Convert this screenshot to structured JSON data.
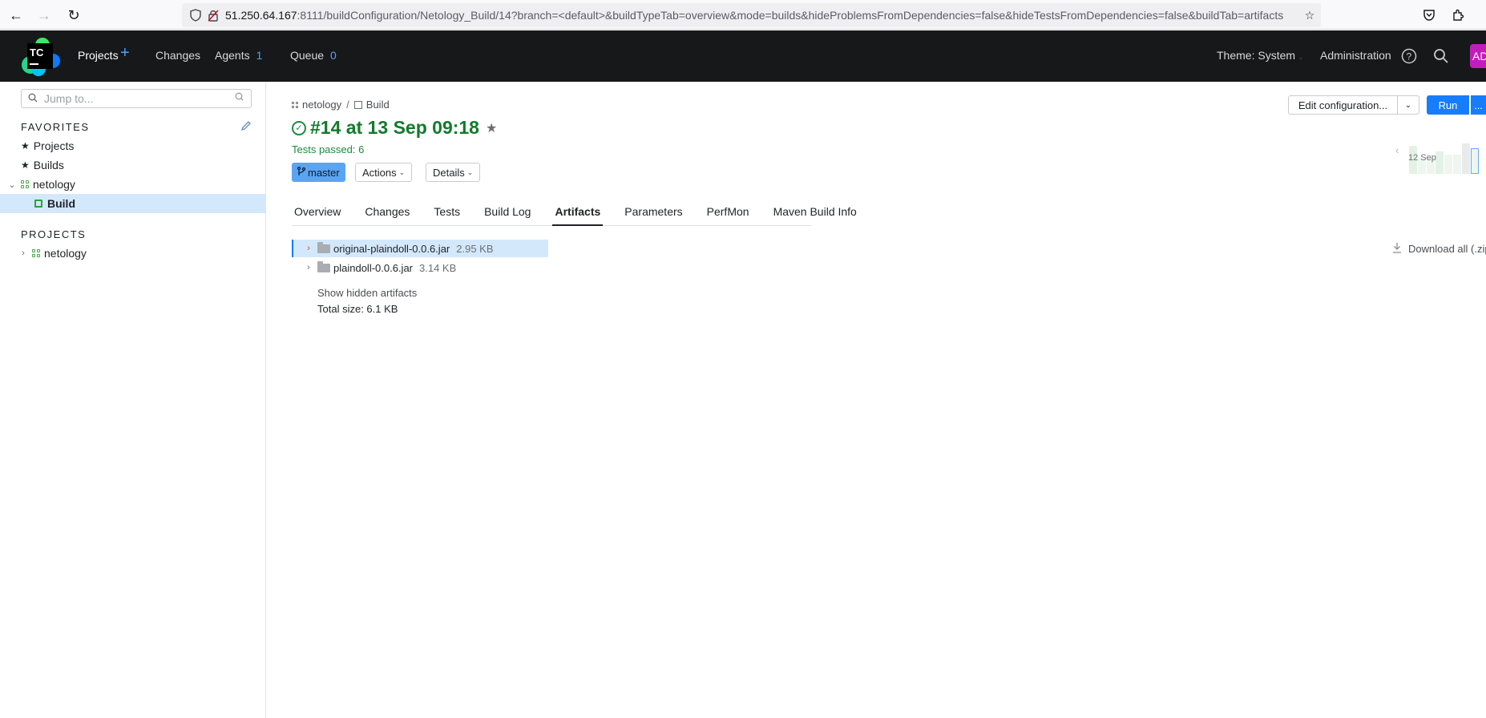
{
  "browser": {
    "url_host": "51.250.64.167",
    "url_rest": ":8111/buildConfiguration/Netology_Build/14?branch=<default>&buildTypeTab=overview&mode=builds&hideProblemsFromDependencies=false&hideTestsFromDependencies=false&buildTab=artifacts"
  },
  "header": {
    "logo_text": "TC",
    "projects": "Projects",
    "changes": "Changes",
    "agents": "Agents",
    "agents_count": "1",
    "queue": "Queue",
    "queue_count": "0",
    "theme": "Theme: System",
    "administration": "Administration",
    "avatar": "AD"
  },
  "sidebar": {
    "search_placeholder": "Jump to...",
    "favorites_title": "FAVORITES",
    "favorites": [
      {
        "label": "Projects"
      },
      {
        "label": "Builds"
      },
      {
        "label": "netology"
      },
      {
        "label": "Build"
      }
    ],
    "projects_title": "PROJECTS",
    "projects": [
      {
        "label": "netology"
      }
    ]
  },
  "breadcrumb": {
    "project": "netology",
    "separator": "/",
    "build": "Build"
  },
  "build": {
    "title": "#14 at 13 Sep 09:18",
    "tests_passed": "Tests passed: 6",
    "branch": "master",
    "actions": "Actions",
    "details": "Details"
  },
  "toolbar": {
    "edit_configuration": "Edit configuration...",
    "run": "Run",
    "run_more": "..."
  },
  "mini_chart": {
    "date": "12 Sep"
  },
  "tabs": [
    "Overview",
    "Changes",
    "Tests",
    "Build Log",
    "Artifacts",
    "Parameters",
    "PerfMon",
    "Maven Build Info"
  ],
  "active_tab": "Artifacts",
  "artifacts": [
    {
      "name": "original-plaindoll-0.0.6.jar",
      "size": "2.95 KB"
    },
    {
      "name": "plaindoll-0.0.6.jar",
      "size": "3.14 KB"
    }
  ],
  "show_hidden": "Show hidden artifacts",
  "total_size": "Total size: 6.1 KB",
  "download_all": "Download all (.zip)",
  "colors": {
    "accent": "#167dff",
    "success": "#137a2c",
    "header_bg": "#16181a",
    "selected_bg": "#d4e8fc"
  }
}
